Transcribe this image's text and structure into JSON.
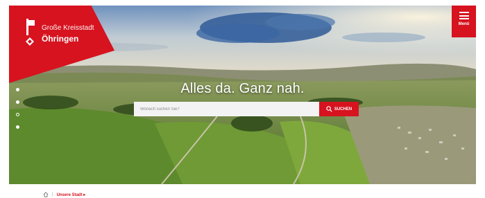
{
  "header": {
    "city_line1": "Große Kreisstadt",
    "city_line2": "Öhringen",
    "menu_label": "Menü"
  },
  "hero": {
    "headline": "Alles da. Ganz nah.",
    "slides": 4
  },
  "search": {
    "placeholder": "Wonach suchen Sie?",
    "button_label": "SUCHEN"
  },
  "breadcrumb": {
    "separator": "|",
    "items": [
      "Unsere Stadt ▸"
    ]
  },
  "colors": {
    "brand_red": "#d6131f",
    "text_light": "#ffffff"
  },
  "icons": [
    "city-key-logo-icon",
    "hamburger-menu-icon",
    "search-icon",
    "home-icon"
  ]
}
